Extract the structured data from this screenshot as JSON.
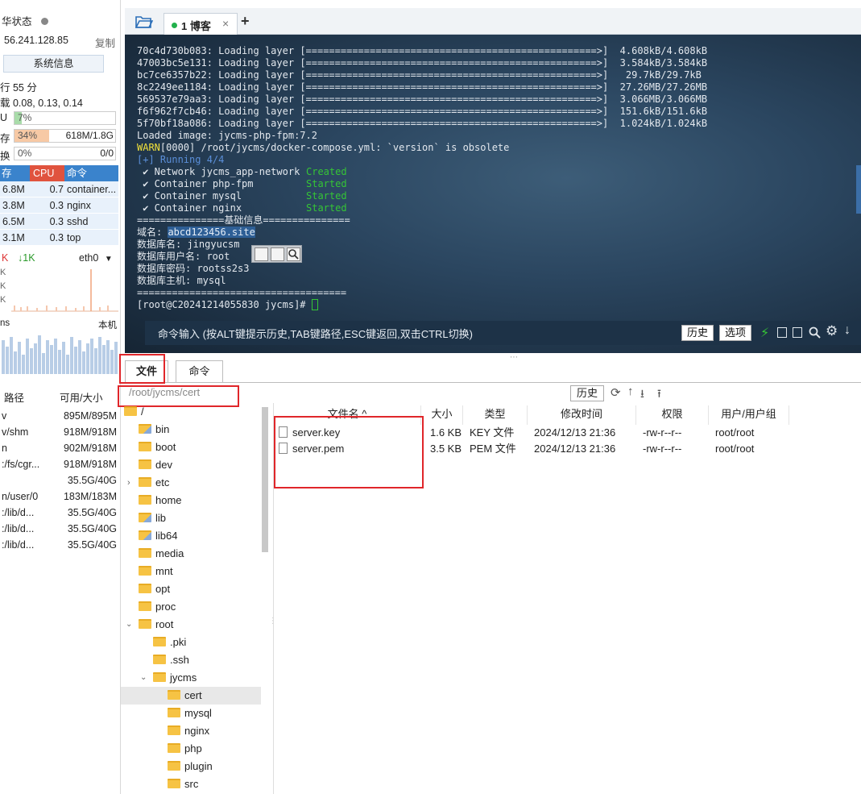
{
  "status_panel": {
    "title": "华状态",
    "ip": "56.241.128.85",
    "copy_label": "复制",
    "sysinfo_button": "系统信息",
    "uptime": "行 55 分",
    "load": "载 0.08, 0.13, 0.14",
    "cpu_label": "U",
    "cpu_value": "7%",
    "cpu_fraction": 0.07,
    "mem_label": "存",
    "mem_percent": "34%",
    "mem_fraction": 0.34,
    "mem_detail": "618M/1.8G",
    "swap_label": "换",
    "swap_percent": "0%",
    "swap_detail": "0/0",
    "proc_headers": {
      "mem": "存",
      "cpu": "CPU",
      "cmd": "命令"
    },
    "processes": [
      {
        "mem": "6.8M",
        "cpu": "0.7",
        "cmd": "container..."
      },
      {
        "mem": "3.8M",
        "cpu": "0.3",
        "cmd": "nginx"
      },
      {
        "mem": "6.5M",
        "cpu": "0.3",
        "cmd": "sshd"
      },
      {
        "mem": "3.1M",
        "cpu": "0.3",
        "cmd": "top"
      }
    ],
    "net_up_prefix": "K",
    "net_down": "↓1K",
    "net_iface": "eth0",
    "net_axis": [
      "K",
      "K",
      "K"
    ],
    "latency_label": "ns",
    "latency_target": "本机",
    "disk_headers": {
      "path": "路径",
      "avail": "可用/大小"
    },
    "disks": [
      {
        "path": "v",
        "avail": "895M/895M"
      },
      {
        "path": "v/shm",
        "avail": "918M/918M"
      },
      {
        "path": "n",
        "avail": "902M/918M"
      },
      {
        "path": ":/fs/cgr...",
        "avail": "918M/918M"
      },
      {
        "path": "",
        "avail": "35.5G/40G"
      },
      {
        "path": "n/user/0",
        "avail": "183M/183M"
      },
      {
        "path": ":/lib/d...",
        "avail": "35.5G/40G"
      },
      {
        "path": ":/lib/d...",
        "avail": "35.5G/40G"
      },
      {
        "path": ":/lib/d...",
        "avail": "35.5G/40G"
      }
    ]
  },
  "tabs": {
    "active_label": "1 博客",
    "close": "×",
    "add": "+"
  },
  "terminal": {
    "layers": [
      {
        "id": "70c4d730b083",
        "size": "4.608kB/4.608kB"
      },
      {
        "id": "47003bc5e131",
        "size": "3.584kB/3.584kB"
      },
      {
        "id": "bc7ce6357b22",
        "size": " 29.7kB/29.7kB"
      },
      {
        "id": "8c2249ee1184",
        "size": "27.26MB/27.26MB"
      },
      {
        "id": "569537e79aa3",
        "size": "3.066MB/3.066MB"
      },
      {
        "id": "f6f962f7cb46",
        "size": "151.6kB/151.6kB"
      },
      {
        "id": "5f70bf18a086",
        "size": "1.024kB/1.024kB"
      }
    ],
    "loading_text": "Loading layer",
    "progress_bar": "[==================================================>]",
    "loaded_image": "Loaded image: jycms-php-fpm:7.2",
    "warn_tag": "WARN",
    "warn_text": "[0000] /root/jycms/docker-compose.yml: `version` is obsolete",
    "running": "[+] Running 4/4",
    "containers": [
      {
        "name": " ✔ Network jycms_app-network",
        "state": "Created"
      },
      {
        "name": " ✔ Container php-fpm",
        "state": "Started"
      },
      {
        "name": " ✔ Container mysql",
        "state": "Started"
      },
      {
        "name": " ✔ Container nginx",
        "state": "Started"
      }
    ],
    "info_header": "===============基础信息===============",
    "domain_label": "域名: ",
    "domain_value": "abcd123456.site",
    "db_name": "数据库名: jingyucsm",
    "db_user": "数据库用户名: root",
    "db_pass": "数据库密码: rootss2s3",
    "db_host": "数据库主机: mysql",
    "info_footer": "====================================",
    "prompt": "[root@C20241214055830 jycms]# ",
    "cmd_hint": "命令输入 (按ALT键提示历史,TAB键路径,ESC键返回,双击CTRL切换)",
    "history_button": "历史",
    "options_button": "选项"
  },
  "file_manager": {
    "tab_files": "文件",
    "tab_commands": "命令",
    "path": "/root/jycms/cert",
    "history_button": "历史",
    "tree": [
      {
        "name": "/",
        "level": 0
      },
      {
        "name": "bin",
        "level": 1,
        "link": true
      },
      {
        "name": "boot",
        "level": 1
      },
      {
        "name": "dev",
        "level": 1
      },
      {
        "name": "etc",
        "level": 1,
        "expandable": true
      },
      {
        "name": "home",
        "level": 1
      },
      {
        "name": "lib",
        "level": 1,
        "link": true
      },
      {
        "name": "lib64",
        "level": 1,
        "link": true
      },
      {
        "name": "media",
        "level": 1
      },
      {
        "name": "mnt",
        "level": 1
      },
      {
        "name": "opt",
        "level": 1
      },
      {
        "name": "proc",
        "level": 1
      },
      {
        "name": "root",
        "level": 1,
        "expanded": true
      },
      {
        "name": ".pki",
        "level": 2
      },
      {
        "name": ".ssh",
        "level": 2
      },
      {
        "name": "jycms",
        "level": 2,
        "expanded": true
      },
      {
        "name": "cert",
        "level": 3,
        "selected": true
      },
      {
        "name": "mysql",
        "level": 3
      },
      {
        "name": "nginx",
        "level": 3
      },
      {
        "name": "php",
        "level": 3
      },
      {
        "name": "plugin",
        "level": 3
      },
      {
        "name": "src",
        "level": 3
      }
    ],
    "columns": [
      "文件名 ^",
      "大小",
      "类型",
      "修改时间",
      "权限",
      "用户/用户组"
    ],
    "files": [
      {
        "name": "server.key",
        "size": "1.6 KB",
        "type": "KEY 文件",
        "mtime": "2024/12/13 21:36",
        "perm": "-rw-r--r--",
        "owner": "root/root"
      },
      {
        "name": "server.pem",
        "size": "3.5 KB",
        "type": "PEM 文件",
        "mtime": "2024/12/13 21:36",
        "perm": "-rw-r--r--",
        "owner": "root/root"
      }
    ]
  },
  "colors": {
    "accent": "#3a83cc",
    "highlight_red": "#e0262a",
    "terminal_green": "#35c535",
    "cpu_bar": "#9fd59f",
    "mem_bar": "#f5c4a0"
  }
}
